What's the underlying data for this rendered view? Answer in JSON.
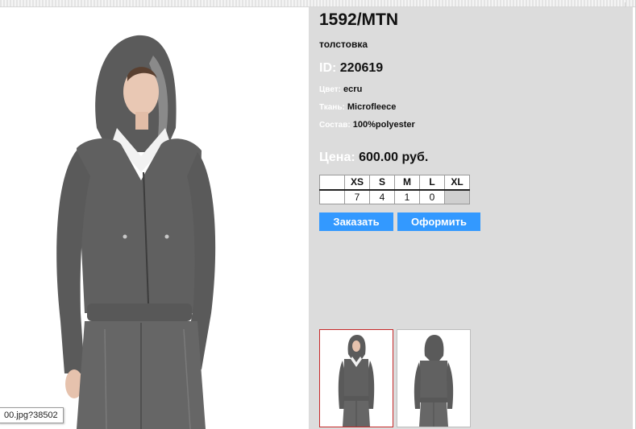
{
  "product": {
    "article": "1592/MTN",
    "type": "толстовка",
    "id_label": "ID:",
    "id_value": "220619",
    "attributes": [
      {
        "label": "Цвет:",
        "value": "ecru"
      },
      {
        "label": "Ткань:",
        "value": "Microfleece"
      },
      {
        "label": "Состав:",
        "value": "100%polyester"
      }
    ],
    "price_label": "Цена:",
    "price_value": "600.00 руб."
  },
  "sizes": {
    "headers": [
      "XS",
      "S",
      "M",
      "L",
      "XL"
    ],
    "quantities": [
      "7",
      "4",
      "1",
      "0",
      ""
    ]
  },
  "buttons": {
    "order": "Заказать",
    "checkout": "Оформить"
  },
  "status_url": "00.jpg?38502",
  "colors": {
    "panel_bg": "#dcdcdc",
    "button_bg": "#3399ff",
    "thumb_active_border": "#c62828",
    "garment": "#5e5e5e"
  }
}
